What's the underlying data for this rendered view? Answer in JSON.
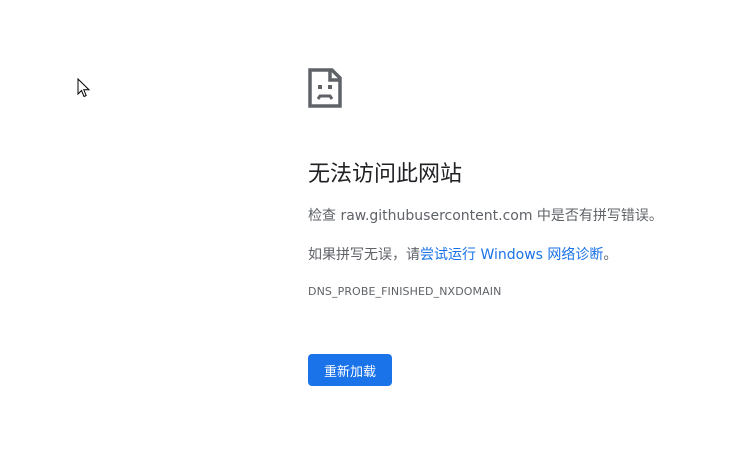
{
  "error": {
    "title": "无法访问此网站",
    "check_prefix": "检查 ",
    "domain": "raw.githubusercontent.com",
    "check_suffix": " 中是否有拼写错误。",
    "hint_prefix": "如果拼写无误，请",
    "diagnostics_link": "尝试运行 Windows 网络诊断",
    "hint_suffix": "。",
    "code": "DNS_PROBE_FINISHED_NXDOMAIN"
  },
  "actions": {
    "reload_label": "重新加载"
  },
  "icons": {
    "error": "sad-page-icon",
    "cursor": "mouse-pointer-icon"
  },
  "colors": {
    "accent": "#1a73e8",
    "title": "#202124",
    "text": "#5f6368"
  }
}
